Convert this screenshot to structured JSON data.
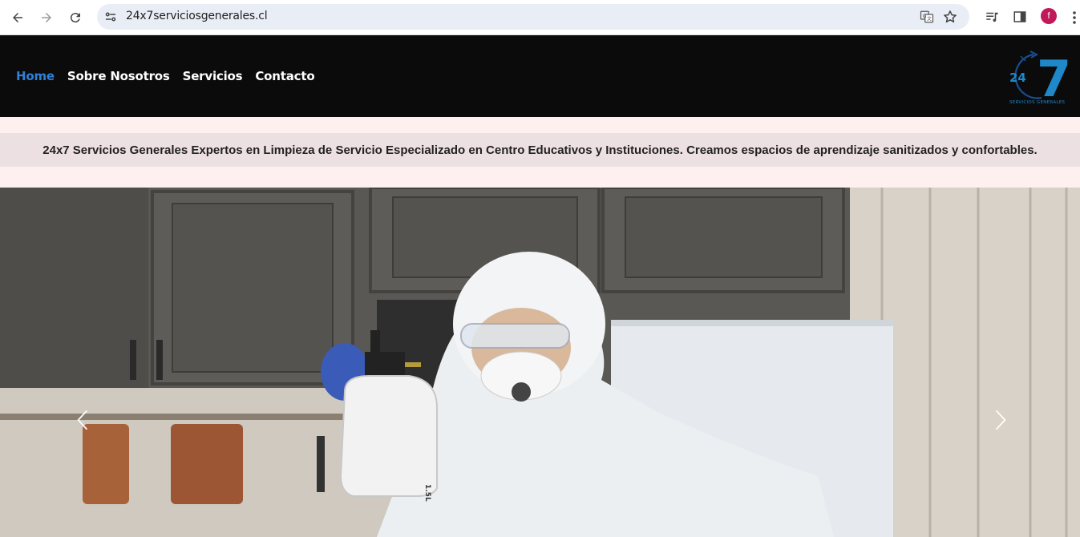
{
  "browser": {
    "url": "24x7serviciosgenerales.cl",
    "avatar_letter": "f"
  },
  "nav": {
    "items": [
      {
        "label": "Home",
        "active": true
      },
      {
        "label": "Sobre Nosotros",
        "active": false
      },
      {
        "label": "Servicios",
        "active": false
      },
      {
        "label": "Contacto",
        "active": false
      }
    ]
  },
  "logo": {
    "number_small": "24",
    "number_big": "7",
    "caption": "SERVICIOS GENERALES"
  },
  "tagline": "24x7 Servicios Generales Expertos en Limpieza de Servicio Especializado en Centro Educativos y Instituciones. Creamos espacios de aprendizaje sanitizados y confortables.",
  "hero": {
    "bottle_label": "1.5L"
  },
  "colors": {
    "header_bg": "#0b0b0b",
    "nav_active": "#2f7fd8",
    "band_outer": "#fff0f0",
    "band_inner": "#ede0e2",
    "logo_blue": "#1e88c8"
  }
}
